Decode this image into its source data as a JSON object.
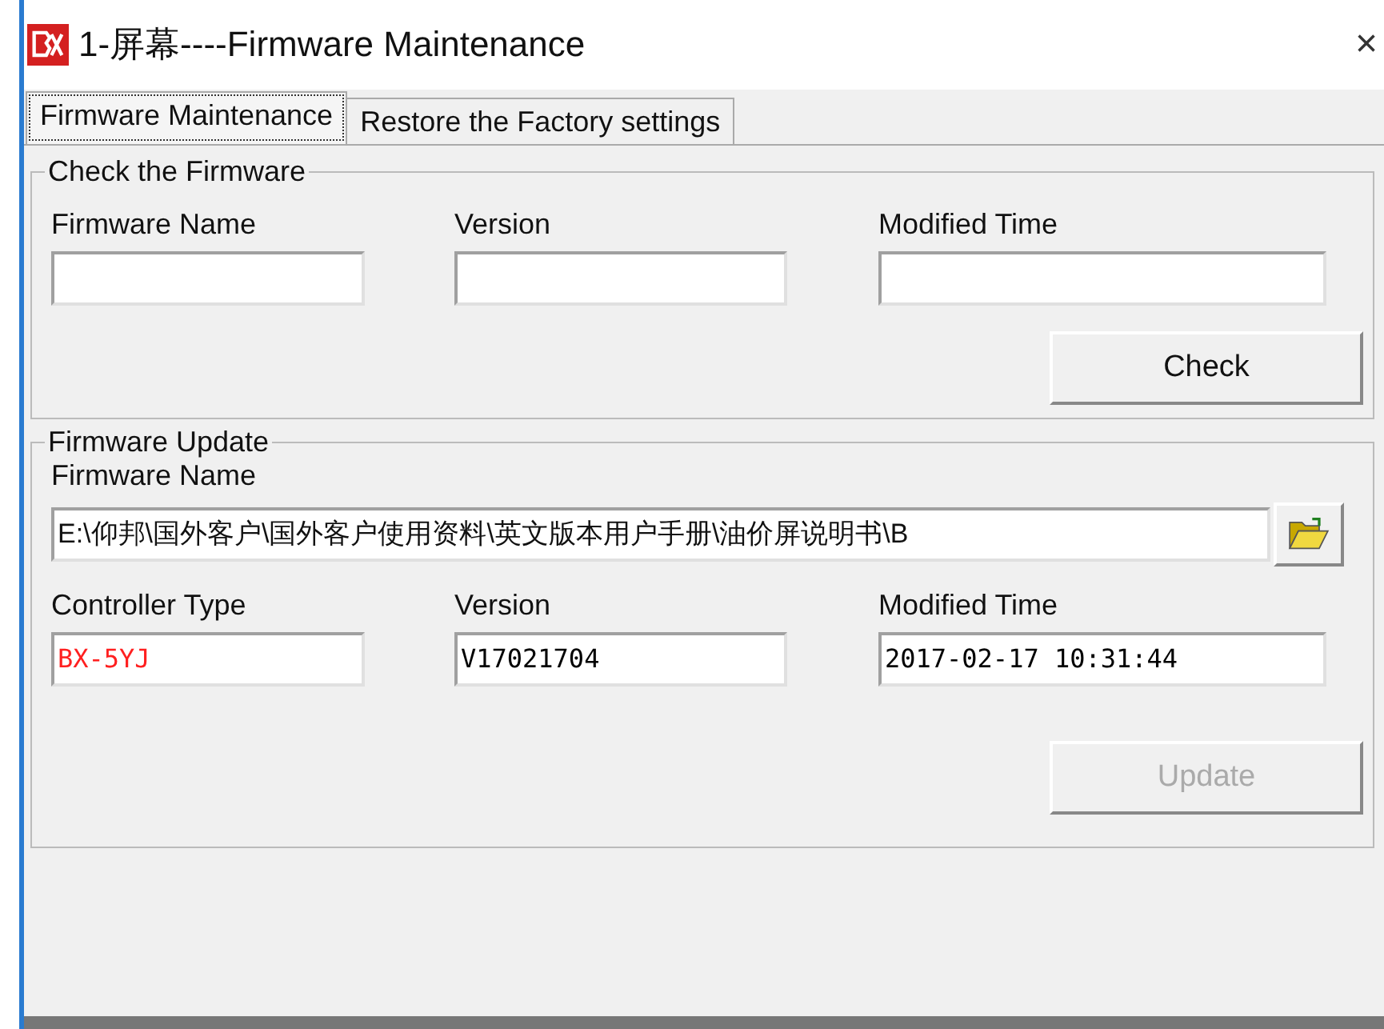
{
  "window": {
    "title": "1-屏幕----Firmware Maintenance",
    "close": "×"
  },
  "tabs": [
    {
      "label": "Firmware Maintenance",
      "selected": true
    },
    {
      "label": "Restore the Factory settings",
      "selected": false
    }
  ],
  "check_group": {
    "title": "Check the Firmware",
    "fields": [
      {
        "label": "Firmware Name"
      },
      {
        "label": "Version"
      },
      {
        "label": "Modified Time"
      }
    ],
    "button": {
      "label": "Check",
      "disabled": false
    }
  },
  "update_group": {
    "title": "Firmware Update",
    "file": {
      "label": "Firmware Name",
      "value": "E:\\仰邦\\国外客户\\国外客户使用资料\\英文版本用户手册\\油价屏说明书\\B"
    },
    "fields": [
      {
        "label": "Controller Type",
        "value": "BX-5YJ",
        "color": "#ff2020"
      },
      {
        "label": "Version",
        "value": "V17021704",
        "color": "#000000"
      },
      {
        "label": "Modified Time",
        "value": "2017-02-17 10:31:44",
        "color": "#000000"
      }
    ],
    "button": {
      "label": "Update",
      "disabled": true
    }
  }
}
